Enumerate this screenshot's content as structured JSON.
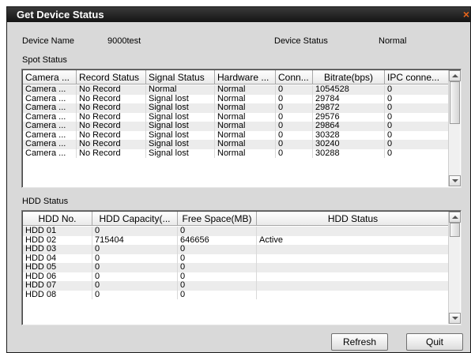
{
  "dialog": {
    "title": "Get Device Status",
    "close_glyph": "×"
  },
  "device": {
    "name_label": "Device Name",
    "name_value": "9000test",
    "status_label": "Device Status",
    "status_value": "Normal"
  },
  "spot": {
    "section_label": "Spot Status",
    "columns": [
      "Camera ...",
      "Record Status",
      "Signal Status",
      "Hardware ...",
      "Conn...",
      "Bitrate(bps)",
      "IPC conne..."
    ],
    "rows": [
      [
        "Camera ...",
        "No Record",
        "Normal",
        "Normal",
        "0",
        "1054528",
        "0"
      ],
      [
        "Camera ...",
        "No Record",
        "Signal lost",
        "Normal",
        "0",
        "29784",
        "0"
      ],
      [
        "Camera ...",
        "No Record",
        "Signal lost",
        "Normal",
        "0",
        "29872",
        "0"
      ],
      [
        "Camera ...",
        "No Record",
        "Signal lost",
        "Normal",
        "0",
        "29576",
        "0"
      ],
      [
        "Camera ...",
        "No Record",
        "Signal lost",
        "Normal",
        "0",
        "29864",
        "0"
      ],
      [
        "Camera ...",
        "No Record",
        "Signal lost",
        "Normal",
        "0",
        "30328",
        "0"
      ],
      [
        "Camera ...",
        "No Record",
        "Signal lost",
        "Normal",
        "0",
        "30240",
        "0"
      ],
      [
        "Camera ...",
        "No Record",
        "Signal lost",
        "Normal",
        "0",
        "30288",
        "0"
      ]
    ]
  },
  "hdd": {
    "section_label": "HDD Status",
    "columns": [
      "HDD No.",
      "HDD Capacity(...",
      "Free Space(MB)",
      "HDD Status"
    ],
    "rows": [
      [
        "HDD 01",
        "0",
        "0",
        ""
      ],
      [
        "HDD 02",
        "715404",
        "646656",
        "Active"
      ],
      [
        "HDD 03",
        "0",
        "0",
        ""
      ],
      [
        "HDD 04",
        "0",
        "0",
        ""
      ],
      [
        "HDD 05",
        "0",
        "0",
        ""
      ],
      [
        "HDD 06",
        "0",
        "0",
        ""
      ],
      [
        "HDD 07",
        "0",
        "0",
        ""
      ],
      [
        "HDD 08",
        "0",
        "0",
        ""
      ]
    ]
  },
  "buttons": {
    "refresh": "Refresh",
    "quit": "Quit"
  }
}
